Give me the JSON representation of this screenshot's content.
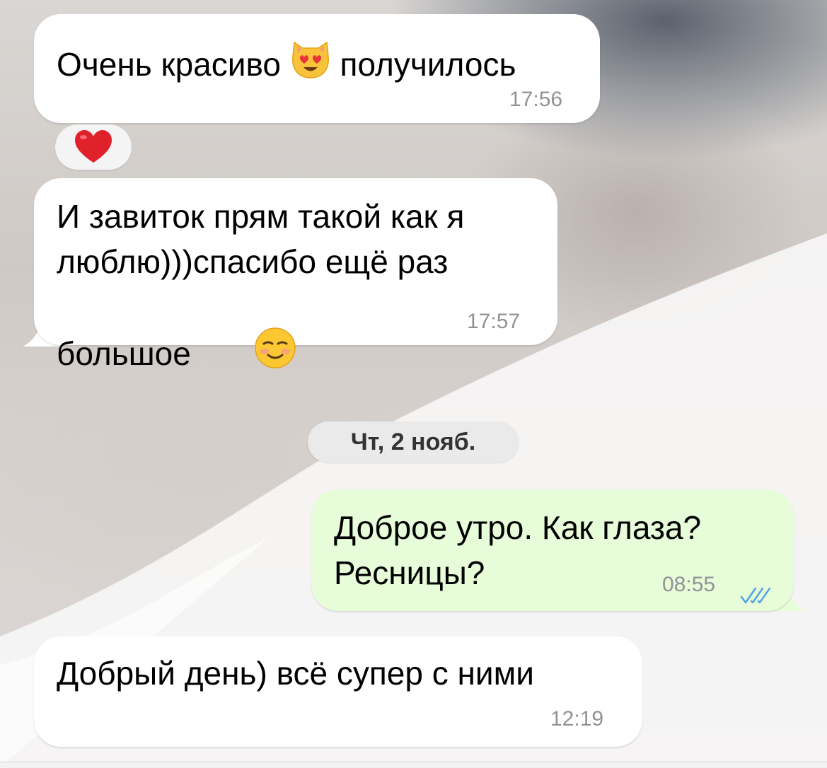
{
  "date_divider": "Чт, 2 нояб.",
  "messages": [
    {
      "direction": "incoming",
      "text_before": "Очень красиво ",
      "emoji": "smiling-cat-heart-eyes-emoji",
      "text_after": " получилось",
      "time": "17:56",
      "reaction": "red-heart-emoji"
    },
    {
      "direction": "incoming",
      "text": "И завиток прям такой как я\nлюблю)))спасибо ещё раз\nбольшое ",
      "emoji": "smiling-face-emoji",
      "time": "17:57"
    },
    {
      "direction": "outgoing",
      "text": "Доброе утро. Как глаза?\nРесницы?",
      "time": "08:55",
      "status": "read-double-check-icon"
    },
    {
      "direction": "incoming",
      "text": "Добрый день) всё супер с ними",
      "time": "12:19"
    }
  ],
  "colors": {
    "incoming_bubble": "#ffffff",
    "outgoing_bubble": "#e7fcd8",
    "time_text": "#8f9396",
    "read_check": "#4fa3e0",
    "heart": "#e0212c"
  }
}
